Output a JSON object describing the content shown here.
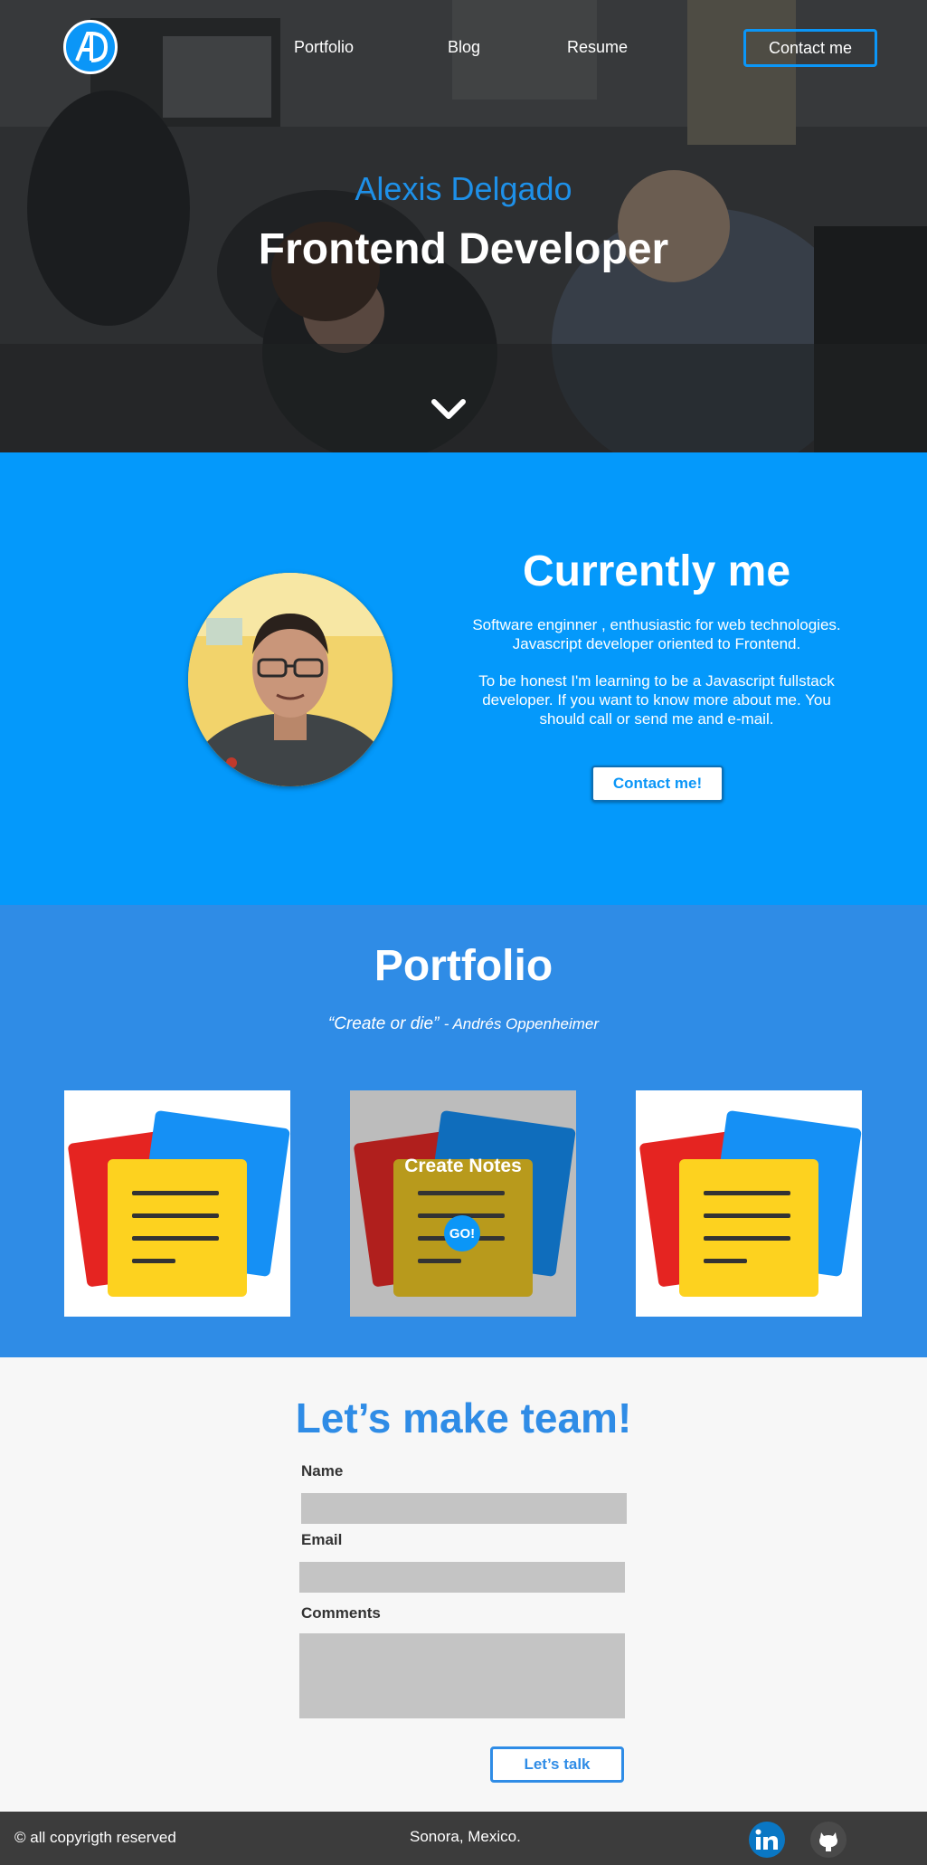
{
  "nav": {
    "logo_text": "AD",
    "items": [
      "Portfolio",
      "Blog",
      "Resume"
    ],
    "contact_label": "Contact me"
  },
  "hero": {
    "name": "Alexis Delgado",
    "role": "Frontend Developer"
  },
  "about": {
    "title": "Currently me",
    "paragraph1": "Software enginner , enthusiastic for web technologies. Javascript developer oriented to Frontend.",
    "paragraph2": "To be honest I'm learning to be a Javascript fullstack developer. If you want to know more about me. You should  call or send me and e-mail.",
    "button_label": "Contact me!"
  },
  "portfolio": {
    "title": "Portfolio",
    "quote": "“Create or die”",
    "quote_author": "- Andrés Oppenheimer",
    "cards": [
      {
        "hovered": false
      },
      {
        "hovered": true,
        "title": "Create Notes",
        "button": "GO!"
      },
      {
        "hovered": false
      }
    ]
  },
  "contact": {
    "title": "Let’s make team!",
    "name_label": "Name",
    "email_label": "Email",
    "comments_label": "Comments",
    "submit_label": "Let’s talk"
  },
  "footer": {
    "copyright": "© all copyrigth reserved",
    "location": "Sonora, Mexico.",
    "icons": [
      "linkedin-icon",
      "github-icon"
    ]
  },
  "colors": {
    "accent": "#0499fb",
    "portfolio_bg": "#2f8ce6",
    "footer_bg": "#3c3c3c"
  }
}
